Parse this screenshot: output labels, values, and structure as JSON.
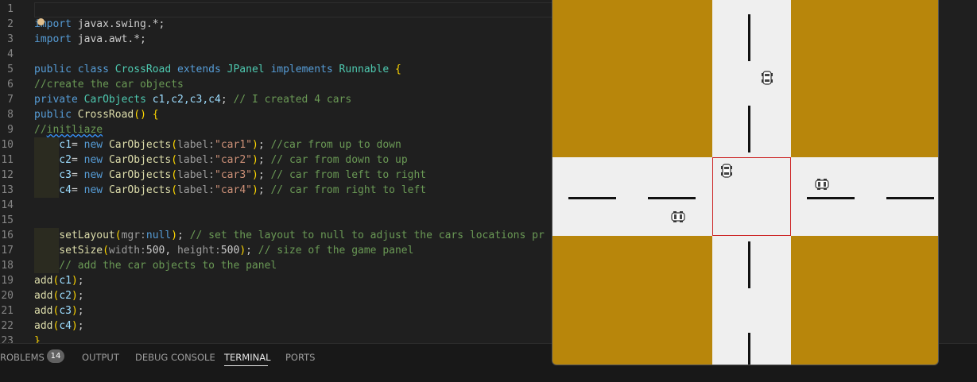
{
  "editor": {
    "lines": [
      {
        "n": "1",
        "tokens": []
      },
      {
        "n": "2",
        "tokens": [
          {
            "t": "import",
            "c": "kw"
          },
          {
            "t": " javax.swing.*;",
            "c": "plain"
          }
        ]
      },
      {
        "n": "3",
        "tokens": [
          {
            "t": "import",
            "c": "kw"
          },
          {
            "t": " java.awt.*;",
            "c": "plain"
          }
        ]
      },
      {
        "n": "4",
        "tokens": []
      },
      {
        "n": "5",
        "tokens": [
          {
            "t": "public class ",
            "c": "kw"
          },
          {
            "t": "CrossRoad ",
            "c": "ty"
          },
          {
            "t": "extends ",
            "c": "kw"
          },
          {
            "t": "JPanel ",
            "c": "ty"
          },
          {
            "t": "implements ",
            "c": "kw"
          },
          {
            "t": "Runnable ",
            "c": "ty"
          },
          {
            "t": "{",
            "c": "br"
          }
        ]
      },
      {
        "n": "6",
        "tokens": [
          {
            "t": "//create the car objects",
            "c": "cm"
          }
        ]
      },
      {
        "n": "7",
        "tokens": [
          {
            "t": "private ",
            "c": "kw"
          },
          {
            "t": "CarObjects ",
            "c": "ty"
          },
          {
            "t": "c1,c2,c3,c4",
            "c": "var"
          },
          {
            "t": "; ",
            "c": "plain"
          },
          {
            "t": "// I created 4 cars",
            "c": "cm"
          }
        ]
      },
      {
        "n": "8",
        "tokens": [
          {
            "t": "public ",
            "c": "kw"
          },
          {
            "t": "CrossRoad",
            "c": "fn"
          },
          {
            "t": "() ",
            "c": "br"
          },
          {
            "t": "{",
            "c": "br"
          }
        ]
      },
      {
        "n": "9",
        "tokens": [
          {
            "t": "//",
            "c": "cm"
          },
          {
            "t": "initliaze",
            "c": "cm squiggle"
          }
        ]
      },
      {
        "n": "10",
        "tokens": [
          {
            "t": "    c1",
            "c": "var"
          },
          {
            "t": "= ",
            "c": "plain"
          },
          {
            "t": "new ",
            "c": "kw"
          },
          {
            "t": "CarObjects",
            "c": "fn"
          },
          {
            "t": "(",
            "c": "br"
          },
          {
            "t": "label:",
            "c": "hint"
          },
          {
            "t": "\"car1\"",
            "c": "str"
          },
          {
            "t": ")",
            "c": "br"
          },
          {
            "t": "; ",
            "c": "plain"
          },
          {
            "t": "//car from up to down",
            "c": "cm"
          }
        ]
      },
      {
        "n": "11",
        "tokens": [
          {
            "t": "    c2",
            "c": "var"
          },
          {
            "t": "= ",
            "c": "plain"
          },
          {
            "t": "new ",
            "c": "kw"
          },
          {
            "t": "CarObjects",
            "c": "fn"
          },
          {
            "t": "(",
            "c": "br"
          },
          {
            "t": "label:",
            "c": "hint"
          },
          {
            "t": "\"car2\"",
            "c": "str"
          },
          {
            "t": ")",
            "c": "br"
          },
          {
            "t": "; ",
            "c": "plain"
          },
          {
            "t": "// car from down to up",
            "c": "cm"
          }
        ]
      },
      {
        "n": "12",
        "tokens": [
          {
            "t": "    c3",
            "c": "var"
          },
          {
            "t": "= ",
            "c": "plain"
          },
          {
            "t": "new ",
            "c": "kw"
          },
          {
            "t": "CarObjects",
            "c": "fn"
          },
          {
            "t": "(",
            "c": "br"
          },
          {
            "t": "label:",
            "c": "hint"
          },
          {
            "t": "\"car3\"",
            "c": "str"
          },
          {
            "t": ")",
            "c": "br"
          },
          {
            "t": "; ",
            "c": "plain"
          },
          {
            "t": "// car from left to right",
            "c": "cm"
          }
        ]
      },
      {
        "n": "13",
        "tokens": [
          {
            "t": "    c4",
            "c": "var"
          },
          {
            "t": "= ",
            "c": "plain"
          },
          {
            "t": "new ",
            "c": "kw"
          },
          {
            "t": "CarObjects",
            "c": "fn"
          },
          {
            "t": "(",
            "c": "br"
          },
          {
            "t": "label:",
            "c": "hint"
          },
          {
            "t": "\"car4\"",
            "c": "str"
          },
          {
            "t": ")",
            "c": "br"
          },
          {
            "t": "; ",
            "c": "plain"
          },
          {
            "t": "// car from right to left",
            "c": "cm"
          }
        ]
      },
      {
        "n": "14",
        "tokens": []
      },
      {
        "n": "15",
        "tokens": []
      },
      {
        "n": "16",
        "tokens": [
          {
            "t": "    setLayout",
            "c": "fn"
          },
          {
            "t": "(",
            "c": "br"
          },
          {
            "t": "mgr:",
            "c": "hint"
          },
          {
            "t": "null",
            "c": "kw"
          },
          {
            "t": ")",
            "c": "br"
          },
          {
            "t": "; ",
            "c": "plain"
          },
          {
            "t": "// set the layout to null to adjust the cars locations pr",
            "c": "cm"
          }
        ]
      },
      {
        "n": "17",
        "tokens": [
          {
            "t": "    setSize",
            "c": "fn"
          },
          {
            "t": "(",
            "c": "br"
          },
          {
            "t": "width:",
            "c": "hint"
          },
          {
            "t": "500",
            "c": "plain"
          },
          {
            "t": ", ",
            "c": "plain"
          },
          {
            "t": "height:",
            "c": "hint"
          },
          {
            "t": "500",
            "c": "plain"
          },
          {
            "t": ")",
            "c": "br"
          },
          {
            "t": "; ",
            "c": "plain"
          },
          {
            "t": "// size of the game panel",
            "c": "cm"
          }
        ]
      },
      {
        "n": "18",
        "tokens": [
          {
            "t": "    // add the car objects to the panel",
            "c": "cm"
          }
        ]
      },
      {
        "n": "19",
        "tokens": [
          {
            "t": "add",
            "c": "fn"
          },
          {
            "t": "(",
            "c": "br"
          },
          {
            "t": "c1",
            "c": "var"
          },
          {
            "t": ")",
            "c": "br"
          },
          {
            "t": ";",
            "c": "plain"
          }
        ]
      },
      {
        "n": "20",
        "tokens": [
          {
            "t": "add",
            "c": "fn"
          },
          {
            "t": "(",
            "c": "br"
          },
          {
            "t": "c2",
            "c": "var"
          },
          {
            "t": ")",
            "c": "br"
          },
          {
            "t": ";",
            "c": "plain"
          }
        ]
      },
      {
        "n": "21",
        "tokens": [
          {
            "t": "add",
            "c": "fn"
          },
          {
            "t": "(",
            "c": "br"
          },
          {
            "t": "c3",
            "c": "var"
          },
          {
            "t": ")",
            "c": "br"
          },
          {
            "t": ";",
            "c": "plain"
          }
        ]
      },
      {
        "n": "22",
        "tokens": [
          {
            "t": "add",
            "c": "fn"
          },
          {
            "t": "(",
            "c": "br"
          },
          {
            "t": "c4",
            "c": "var"
          },
          {
            "t": ")",
            "c": "br"
          },
          {
            "t": ";",
            "c": "plain"
          }
        ]
      },
      {
        "n": "23",
        "tokens": [
          {
            "t": "}",
            "c": "br"
          }
        ]
      }
    ]
  },
  "panel": {
    "tabs": [
      {
        "label": "ROBLEMS",
        "active": false
      },
      {
        "label": "OUTPUT",
        "active": false
      },
      {
        "label": "DEBUG CONSOLE",
        "active": false
      },
      {
        "label": "TERMINAL",
        "active": true
      },
      {
        "label": "PORTS",
        "active": false
      }
    ],
    "problems_count": "14"
  },
  "colors": {
    "grass": "#b8860b",
    "road": "#efefef",
    "intersection_border": "#cc2222"
  }
}
